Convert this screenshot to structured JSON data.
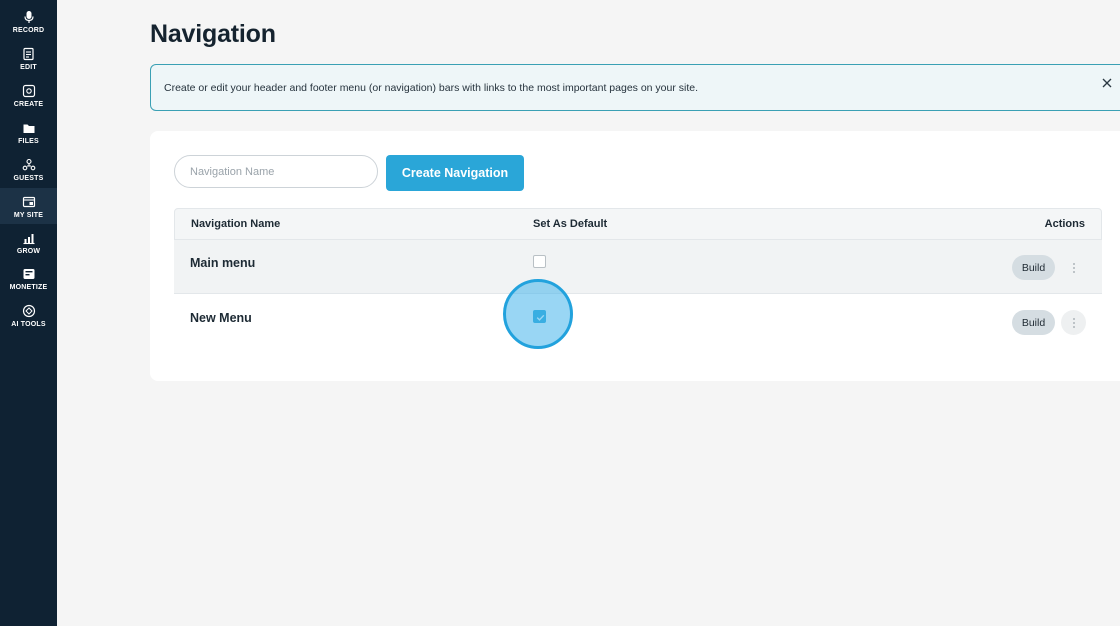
{
  "sidebar": {
    "items": [
      {
        "label": "RECORD",
        "icon": "microphone-icon"
      },
      {
        "label": "EDIT",
        "icon": "edit-icon"
      },
      {
        "label": "CREATE",
        "icon": "create-icon"
      },
      {
        "label": "FILES",
        "icon": "files-icon"
      },
      {
        "label": "GUESTS",
        "icon": "guests-icon"
      },
      {
        "label": "MY SITE",
        "icon": "my-site-icon"
      },
      {
        "label": "GROW",
        "icon": "chart-icon"
      },
      {
        "label": "MONETIZE",
        "icon": "monetize-icon"
      },
      {
        "label": "AI TOOLS",
        "icon": "ai-tools-icon"
      }
    ],
    "active": "MY SITE"
  },
  "page": {
    "title": "Navigation",
    "banner_text": "Create or edit your header and footer menu (or navigation) bars with links to the most important pages on your site."
  },
  "create_form": {
    "input_placeholder": "Navigation Name",
    "input_value": "",
    "button_label": "Create Navigation"
  },
  "table": {
    "headers": {
      "name": "Navigation Name",
      "default": "Set As Default",
      "actions": "Actions"
    },
    "rows": [
      {
        "name": "Main menu",
        "is_default": false,
        "build_label": "Build"
      },
      {
        "name": "New Menu",
        "is_default": true,
        "build_label": "Build"
      }
    ]
  },
  "colors": {
    "sidebar_bg": "#0f2233",
    "accent": "#2aa6d8",
    "banner_border": "#3aa0b4"
  }
}
